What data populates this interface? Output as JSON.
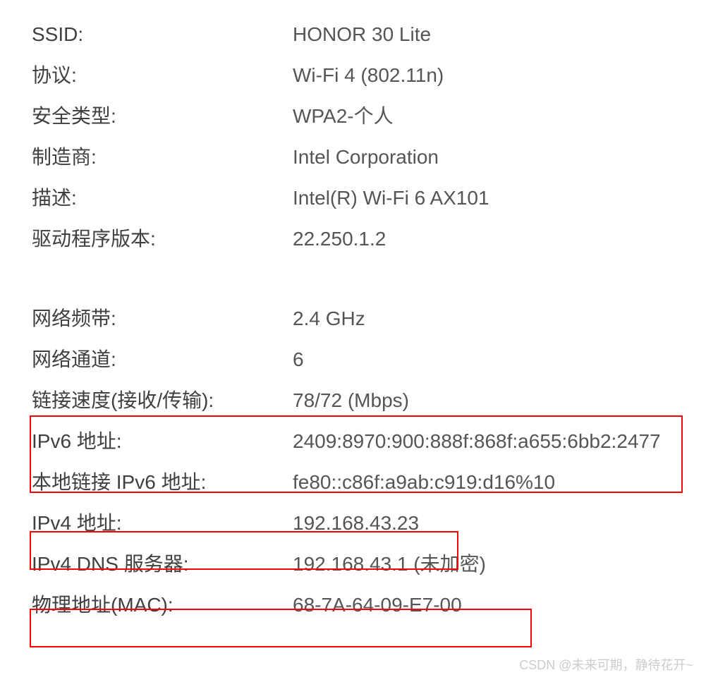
{
  "properties": {
    "ssid": {
      "label": "SSID:",
      "value": "HONOR 30 Lite"
    },
    "protocol": {
      "label": "协议:",
      "value": "Wi-Fi 4 (802.11n)"
    },
    "security": {
      "label": "安全类型:",
      "value": "WPA2-个人"
    },
    "manufacturer": {
      "label": "制造商:",
      "value": "Intel Corporation"
    },
    "description": {
      "label": "描述:",
      "value": "Intel(R) Wi-Fi 6 AX101"
    },
    "driver": {
      "label": "驱动程序版本:",
      "value": "22.250.1.2"
    },
    "band": {
      "label": "网络频带:",
      "value": "2.4 GHz"
    },
    "channel": {
      "label": "网络通道:",
      "value": "6"
    },
    "linkspeed": {
      "label": "链接速度(接收/传输):",
      "value": "78/72 (Mbps)"
    },
    "ipv6": {
      "label": "IPv6 地址:",
      "value": "2409:8970:900:888f:868f:a655:6bb2:2477"
    },
    "ipv6local": {
      "label": "本地链接 IPv6 地址:",
      "value": "fe80::c86f:a9ab:c919:d16%10"
    },
    "ipv4": {
      "label": "IPv4 地址:",
      "value": "192.168.43.23"
    },
    "ipv4dns": {
      "label": "IPv4 DNS 服务器:",
      "value": "192.168.43.1 (未加密)"
    },
    "mac": {
      "label": "物理地址(MAC):",
      "value": "68-7A-64-09-E7-00"
    }
  },
  "watermark": "CSDN @未来可期，静待花开~"
}
